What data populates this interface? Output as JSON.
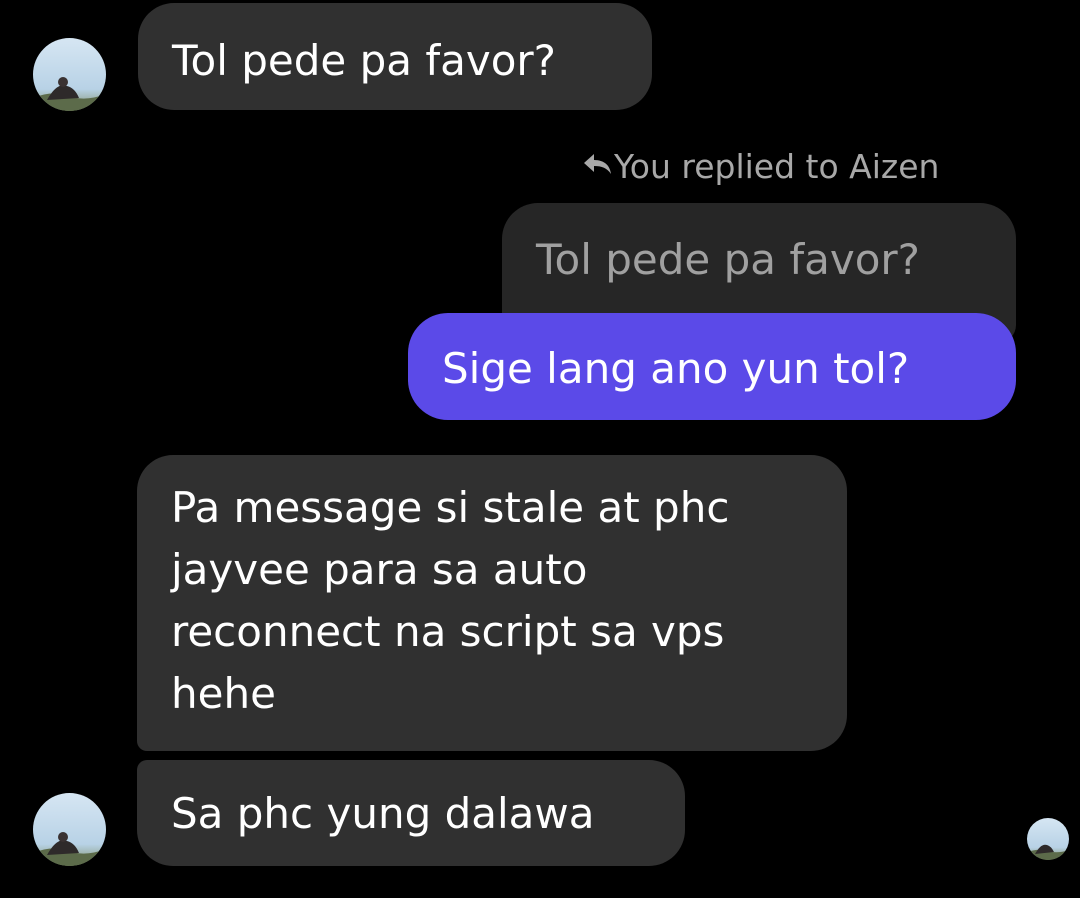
{
  "conversation": {
    "reply_header": "You replied to Aizen",
    "messages": {
      "msg1": "Tol pede pa favor?",
      "quoted": "Tol pede pa favor?",
      "msg2": "Sige lang ano yun tol?",
      "msg3_lines": [
        "Pa message si stale at phc",
        "jayvee para sa auto",
        "reconnect na script sa vps",
        "hehe"
      ],
      "msg4": "Sa phc yung dalawa"
    }
  },
  "colors": {
    "background": "#000000",
    "incoming_bubble": "#303030",
    "quoted_bubble": "#262626",
    "outgoing_bubble": "#5b4ae8",
    "muted_text": "#a8a8a8"
  },
  "icons": {
    "reply": "reply-arrow-icon",
    "avatar": "contact-avatar"
  }
}
